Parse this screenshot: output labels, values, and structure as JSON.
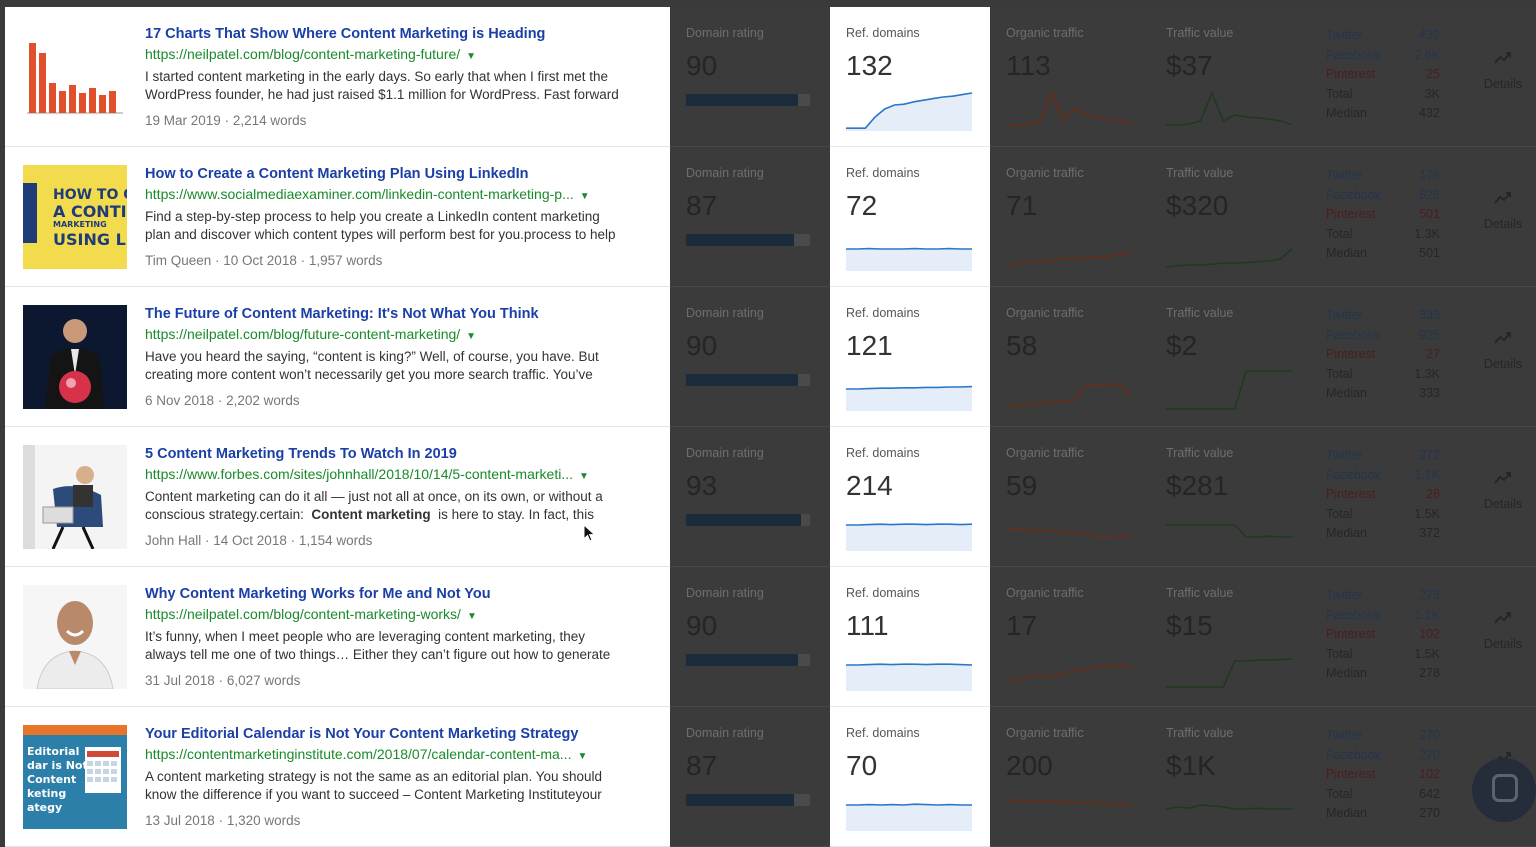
{
  "columns": {
    "domain_rating": "Domain rating",
    "ref_domains": "Ref. domains",
    "organic_traffic": "Organic traffic",
    "traffic_value": "Traffic value",
    "details": "Details"
  },
  "social_labels": {
    "twitter": "Twitter",
    "facebook": "Facebook",
    "pinterest": "Pinterest",
    "total": "Total",
    "median": "Median"
  },
  "colors": {
    "link": "#1a3fa6",
    "url": "#1a8a2a",
    "ref_spark": "#2c76c7",
    "organic_spark": "#6a2e18",
    "value_spark": "#1e3a1e",
    "dim_overlay": "#3b3b3b"
  },
  "rows": [
    {
      "title": "17 Charts That Show Where Content Marketing is Heading",
      "url": "https://neilpatel.com/blog/content-marketing-future/",
      "snippet_1": "I started content marketing in the early days. So early that when I first met the",
      "snippet_2": "WordPress founder, he had just raised $1.1 million for WordPress. Fast forward",
      "author": "",
      "date": "19 Mar 2019",
      "words": "2,214 words",
      "thumb": "bar-chart-thumbnail",
      "dr": "90",
      "dr_pct": 0.9,
      "ref": "132",
      "org": "113",
      "val": "$37",
      "tw": "432",
      "fb": "2.6K",
      "pi": "25",
      "total": "3K",
      "median": "432",
      "ref_trend": [
        0.02,
        0.02,
        0.02,
        0.3,
        0.5,
        0.6,
        0.62,
        0.68,
        0.72,
        0.76,
        0.8,
        0.82,
        0.86,
        0.9
      ],
      "org_trend": [
        0.1,
        0.1,
        0.12,
        0.2,
        0.9,
        0.25,
        0.5,
        0.35,
        0.3,
        0.25,
        0.2,
        0.15
      ],
      "val_trend": [
        0.1,
        0.1,
        0.12,
        0.2,
        0.9,
        0.2,
        0.35,
        0.3,
        0.28,
        0.25,
        0.2,
        0.1
      ]
    },
    {
      "title": "How to Create a Content Marketing Plan Using LinkedIn",
      "url": "https://www.socialmediaexaminer.com/linkedin-content-marketing-p...",
      "snippet_1": "Find a step-by-step process to help you create a LinkedIn content marketing",
      "snippet_2": "plan and discover which content types will perform best for you.process to help",
      "author": "Tim Queen",
      "date": "10 Oct 2018",
      "words": "1,957 words",
      "thumb": "linkedin-book-cover-thumbnail",
      "dr": "87",
      "dr_pct": 0.87,
      "ref": "72",
      "org": "71",
      "val": "$320",
      "tw": "176",
      "fb": "626",
      "pi": "501",
      "total": "1.3K",
      "median": "501",
      "ref_trend": [
        0.5,
        0.5,
        0.51,
        0.5,
        0.5,
        0.5,
        0.51,
        0.5,
        0.5,
        0.51,
        0.5,
        0.5
      ],
      "org_trend": [
        0.05,
        0.15,
        0.2,
        0.18,
        0.22,
        0.25,
        0.24,
        0.28,
        0.3,
        0.32,
        0.35,
        0.45
      ],
      "val_trend": [
        0.05,
        0.08,
        0.1,
        0.1,
        0.12,
        0.15,
        0.14,
        0.16,
        0.18,
        0.2,
        0.25,
        0.5
      ]
    },
    {
      "title": "The Future of Content Marketing: It's Not What You Think",
      "url": "https://neilpatel.com/blog/future-content-marketing/",
      "snippet_1": "Have you heard the saying, “content is king?” Well, of course, you have. But",
      "snippet_2": "creating more content won’t necessarily get you more search traffic. You’ve",
      "author": "",
      "date": "6 Nov 2018",
      "words": "2,202 words",
      "thumb": "businessman-crystal-ball-thumbnail",
      "dr": "90",
      "dr_pct": 0.9,
      "ref": "121",
      "org": "58",
      "val": "$2",
      "tw": "333",
      "fb": "925",
      "pi": "27",
      "total": "1.3K",
      "median": "333",
      "ref_trend": [
        0.5,
        0.5,
        0.51,
        0.52,
        0.52,
        0.53,
        0.53,
        0.54,
        0.54,
        0.55,
        0.55,
        0.56
      ],
      "org_trend": [
        0.05,
        0.1,
        0.12,
        0.15,
        0.18,
        0.2,
        0.22,
        0.6,
        0.6,
        0.62,
        0.6,
        0.3
      ],
      "val_trend": [
        0.0,
        0.0,
        0.0,
        0.0,
        0.0,
        0.0,
        0.0,
        0.95,
        0.95,
        0.95,
        0.95,
        0.95
      ]
    },
    {
      "title": "5 Content Marketing Trends To Watch In 2019",
      "url": "https://www.forbes.com/sites/johnhall/2018/10/14/5-content-marketi...",
      "snippet_1": "Content marketing can do it all — just not all at once, on its own, or without a",
      "snippet_2a": "conscious strategy.certain:",
      "snippet_2b": "Content marketing",
      "snippet_2c": "is here to stay. In fact, this",
      "author": "John Hall",
      "date": "14 Oct 2018",
      "words": "1,154 words",
      "thumb": "woman-chair-laptop-thumbnail",
      "dr": "93",
      "dr_pct": 0.93,
      "ref": "214",
      "org": "59",
      "val": "$281",
      "tw": "372",
      "fb": "1.1K",
      "pi": "28",
      "total": "1.5K",
      "median": "372",
      "ref_trend": [
        0.6,
        0.6,
        0.61,
        0.62,
        0.61,
        0.62,
        0.62,
        0.61,
        0.62,
        0.62,
        0.61,
        0.62
      ],
      "org_trend": [
        0.5,
        0.5,
        0.48,
        0.45,
        0.45,
        0.42,
        0.4,
        0.4,
        0.3,
        0.3,
        0.32,
        0.3
      ],
      "val_trend": [
        0.6,
        0.6,
        0.6,
        0.6,
        0.6,
        0.6,
        0.6,
        0.3,
        0.3,
        0.32,
        0.3,
        0.3
      ]
    },
    {
      "title": "Why Content Marketing Works for Me and Not You",
      "url": "https://neilpatel.com/blog/content-marketing-works/",
      "snippet_1": "It’s funny, when I meet people who are leveraging content marketing, they",
      "snippet_2": "always tell me one of two things… Either they can’t figure out how to generate",
      "author": "",
      "date": "31 Jul 2018",
      "words": "6,027 words",
      "thumb": "smiling-man-portrait-thumbnail",
      "dr": "90",
      "dr_pct": 0.9,
      "ref": "111",
      "org": "17",
      "val": "$15",
      "tw": "278",
      "fb": "1.1K",
      "pi": "102",
      "total": "1.5K",
      "median": "278",
      "ref_trend": [
        0.6,
        0.6,
        0.61,
        0.62,
        0.61,
        0.62,
        0.62,
        0.61,
        0.62,
        0.62,
        0.61,
        0.6
      ],
      "org_trend": [
        0.2,
        0.25,
        0.3,
        0.35,
        0.3,
        0.4,
        0.45,
        0.5,
        0.55,
        0.58,
        0.6,
        0.55
      ],
      "val_trend": [
        0.05,
        0.05,
        0.05,
        0.05,
        0.05,
        0.05,
        0.7,
        0.7,
        0.72,
        0.72,
        0.74,
        0.75
      ]
    },
    {
      "title": "Your Editorial Calendar is Not Your Content Marketing Strategy",
      "url": "https://contentmarketinginstitute.com/2018/07/calendar-content-ma...",
      "snippet_1": "A content marketing strategy is not the same as an editorial plan. You should",
      "snippet_2": "know the difference if you want to succeed – Content Marketing Instituteyour",
      "author": "",
      "date": "13 Jul 2018",
      "words": "1,320 words",
      "thumb": "editorial-calendar-thumbnail",
      "dr": "87",
      "dr_pct": 0.87,
      "ref": "70",
      "org": "200",
      "val": "$1K",
      "tw": "270",
      "fb": "270",
      "pi": "102",
      "total": "642",
      "median": "270",
      "ref_trend": [
        0.6,
        0.6,
        0.61,
        0.6,
        0.61,
        0.6,
        0.62,
        0.61,
        0.6,
        0.61,
        0.6,
        0.6
      ],
      "org_trend": [
        0.7,
        0.72,
        0.7,
        0.68,
        0.7,
        0.68,
        0.65,
        0.66,
        0.64,
        0.62,
        0.62,
        0.6
      ],
      "val_trend": [
        0.5,
        0.55,
        0.52,
        0.6,
        0.58,
        0.55,
        0.5,
        0.5,
        0.52,
        0.5,
        0.5,
        0.5
      ]
    }
  ]
}
